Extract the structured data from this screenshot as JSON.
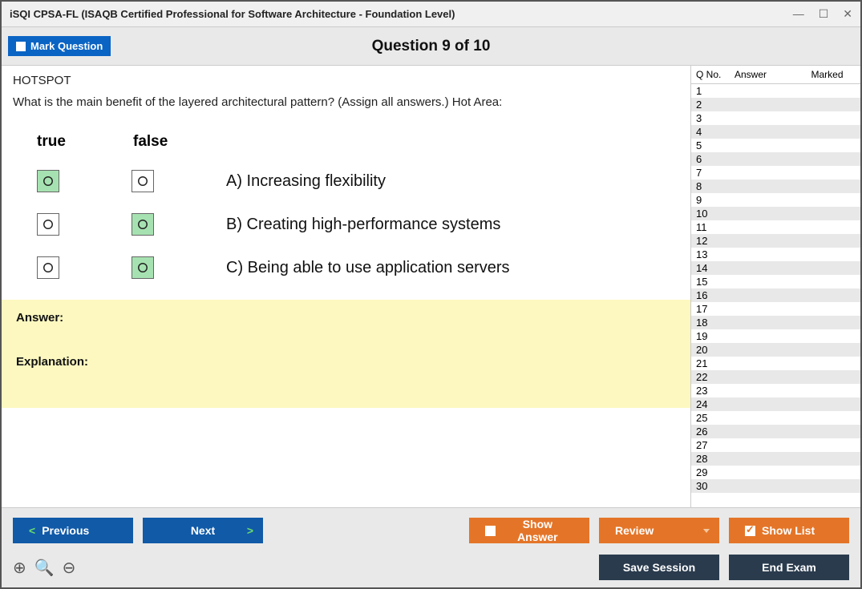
{
  "window": {
    "title": "iSQI CPSA-FL (ISAQB Certified Professional for Software Architecture - Foundation Level)"
  },
  "toolbar": {
    "mark_label": "Mark Question",
    "counter": "Question 9 of 10"
  },
  "question": {
    "type_label": "HOTSPOT",
    "text": "What is the main benefit of the layered architectural pattern? (Assign all answers.) Hot Area:",
    "col_true": "true",
    "col_false": "false",
    "options": [
      {
        "text": "A) Increasing flexibility",
        "true_state": "green",
        "false_state": "white"
      },
      {
        "text": "B) Creating high-performance systems",
        "true_state": "white",
        "false_state": "green"
      },
      {
        "text": "C) Being able to use application servers",
        "true_state": "white",
        "false_state": "green"
      }
    ]
  },
  "answer_panel": {
    "answer_label": "Answer:",
    "explanation_label": "Explanation:"
  },
  "side": {
    "col_qno": "Q No.",
    "col_answer": "Answer",
    "col_marked": "Marked",
    "rows": [
      "1",
      "2",
      "3",
      "4",
      "5",
      "6",
      "7",
      "8",
      "9",
      "10",
      "11",
      "12",
      "13",
      "14",
      "15",
      "16",
      "17",
      "18",
      "19",
      "20",
      "21",
      "22",
      "23",
      "24",
      "25",
      "26",
      "27",
      "28",
      "29",
      "30"
    ]
  },
  "buttons": {
    "previous": "Previous",
    "next": "Next",
    "show_answer": "Show Answer",
    "review": "Review",
    "show_list": "Show List",
    "save_session": "Save Session",
    "end_exam": "End Exam"
  }
}
